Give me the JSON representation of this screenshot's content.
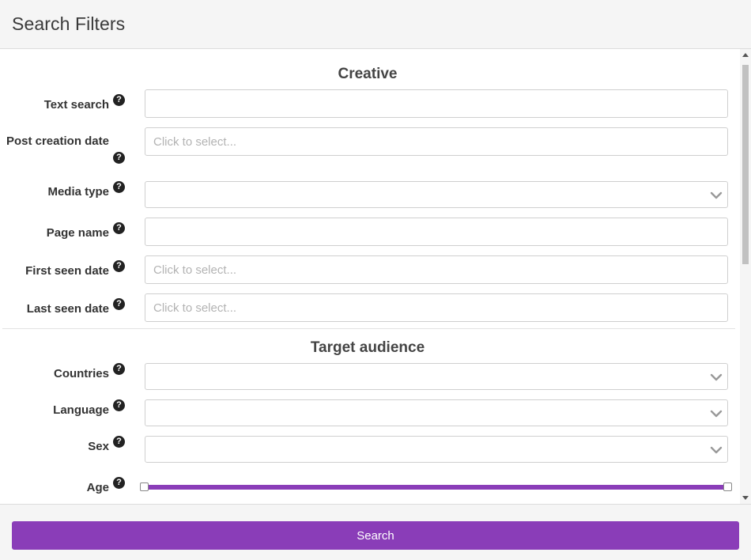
{
  "header": {
    "title": "Search Filters"
  },
  "sections": {
    "creative": {
      "title": "Creative",
      "fields": {
        "text_search": {
          "label": "Text search",
          "value": "",
          "placeholder": ""
        },
        "post_creation_date": {
          "label": "Post creation date",
          "placeholder": "Click to select..."
        },
        "media_type": {
          "label": "Media type",
          "value": ""
        },
        "page_name": {
          "label": "Page name",
          "value": "",
          "placeholder": ""
        },
        "first_seen_date": {
          "label": "First seen date",
          "placeholder": "Click to select..."
        },
        "last_seen_date": {
          "label": "Last seen date",
          "placeholder": "Click to select..."
        }
      }
    },
    "target_audience": {
      "title": "Target audience",
      "fields": {
        "countries": {
          "label": "Countries",
          "value": ""
        },
        "language": {
          "label": "Language",
          "value": ""
        },
        "sex": {
          "label": "Sex",
          "value": ""
        },
        "age": {
          "label": "Age",
          "range_fraction": [
            0.0,
            1.0
          ]
        }
      }
    }
  },
  "icons": {
    "help": "question-circle-icon",
    "chevron": "chevron-down-icon"
  },
  "footer": {
    "search_label": "Search"
  },
  "colors": {
    "accent": "#8a3db8",
    "header_bg": "#f5f5f5"
  }
}
